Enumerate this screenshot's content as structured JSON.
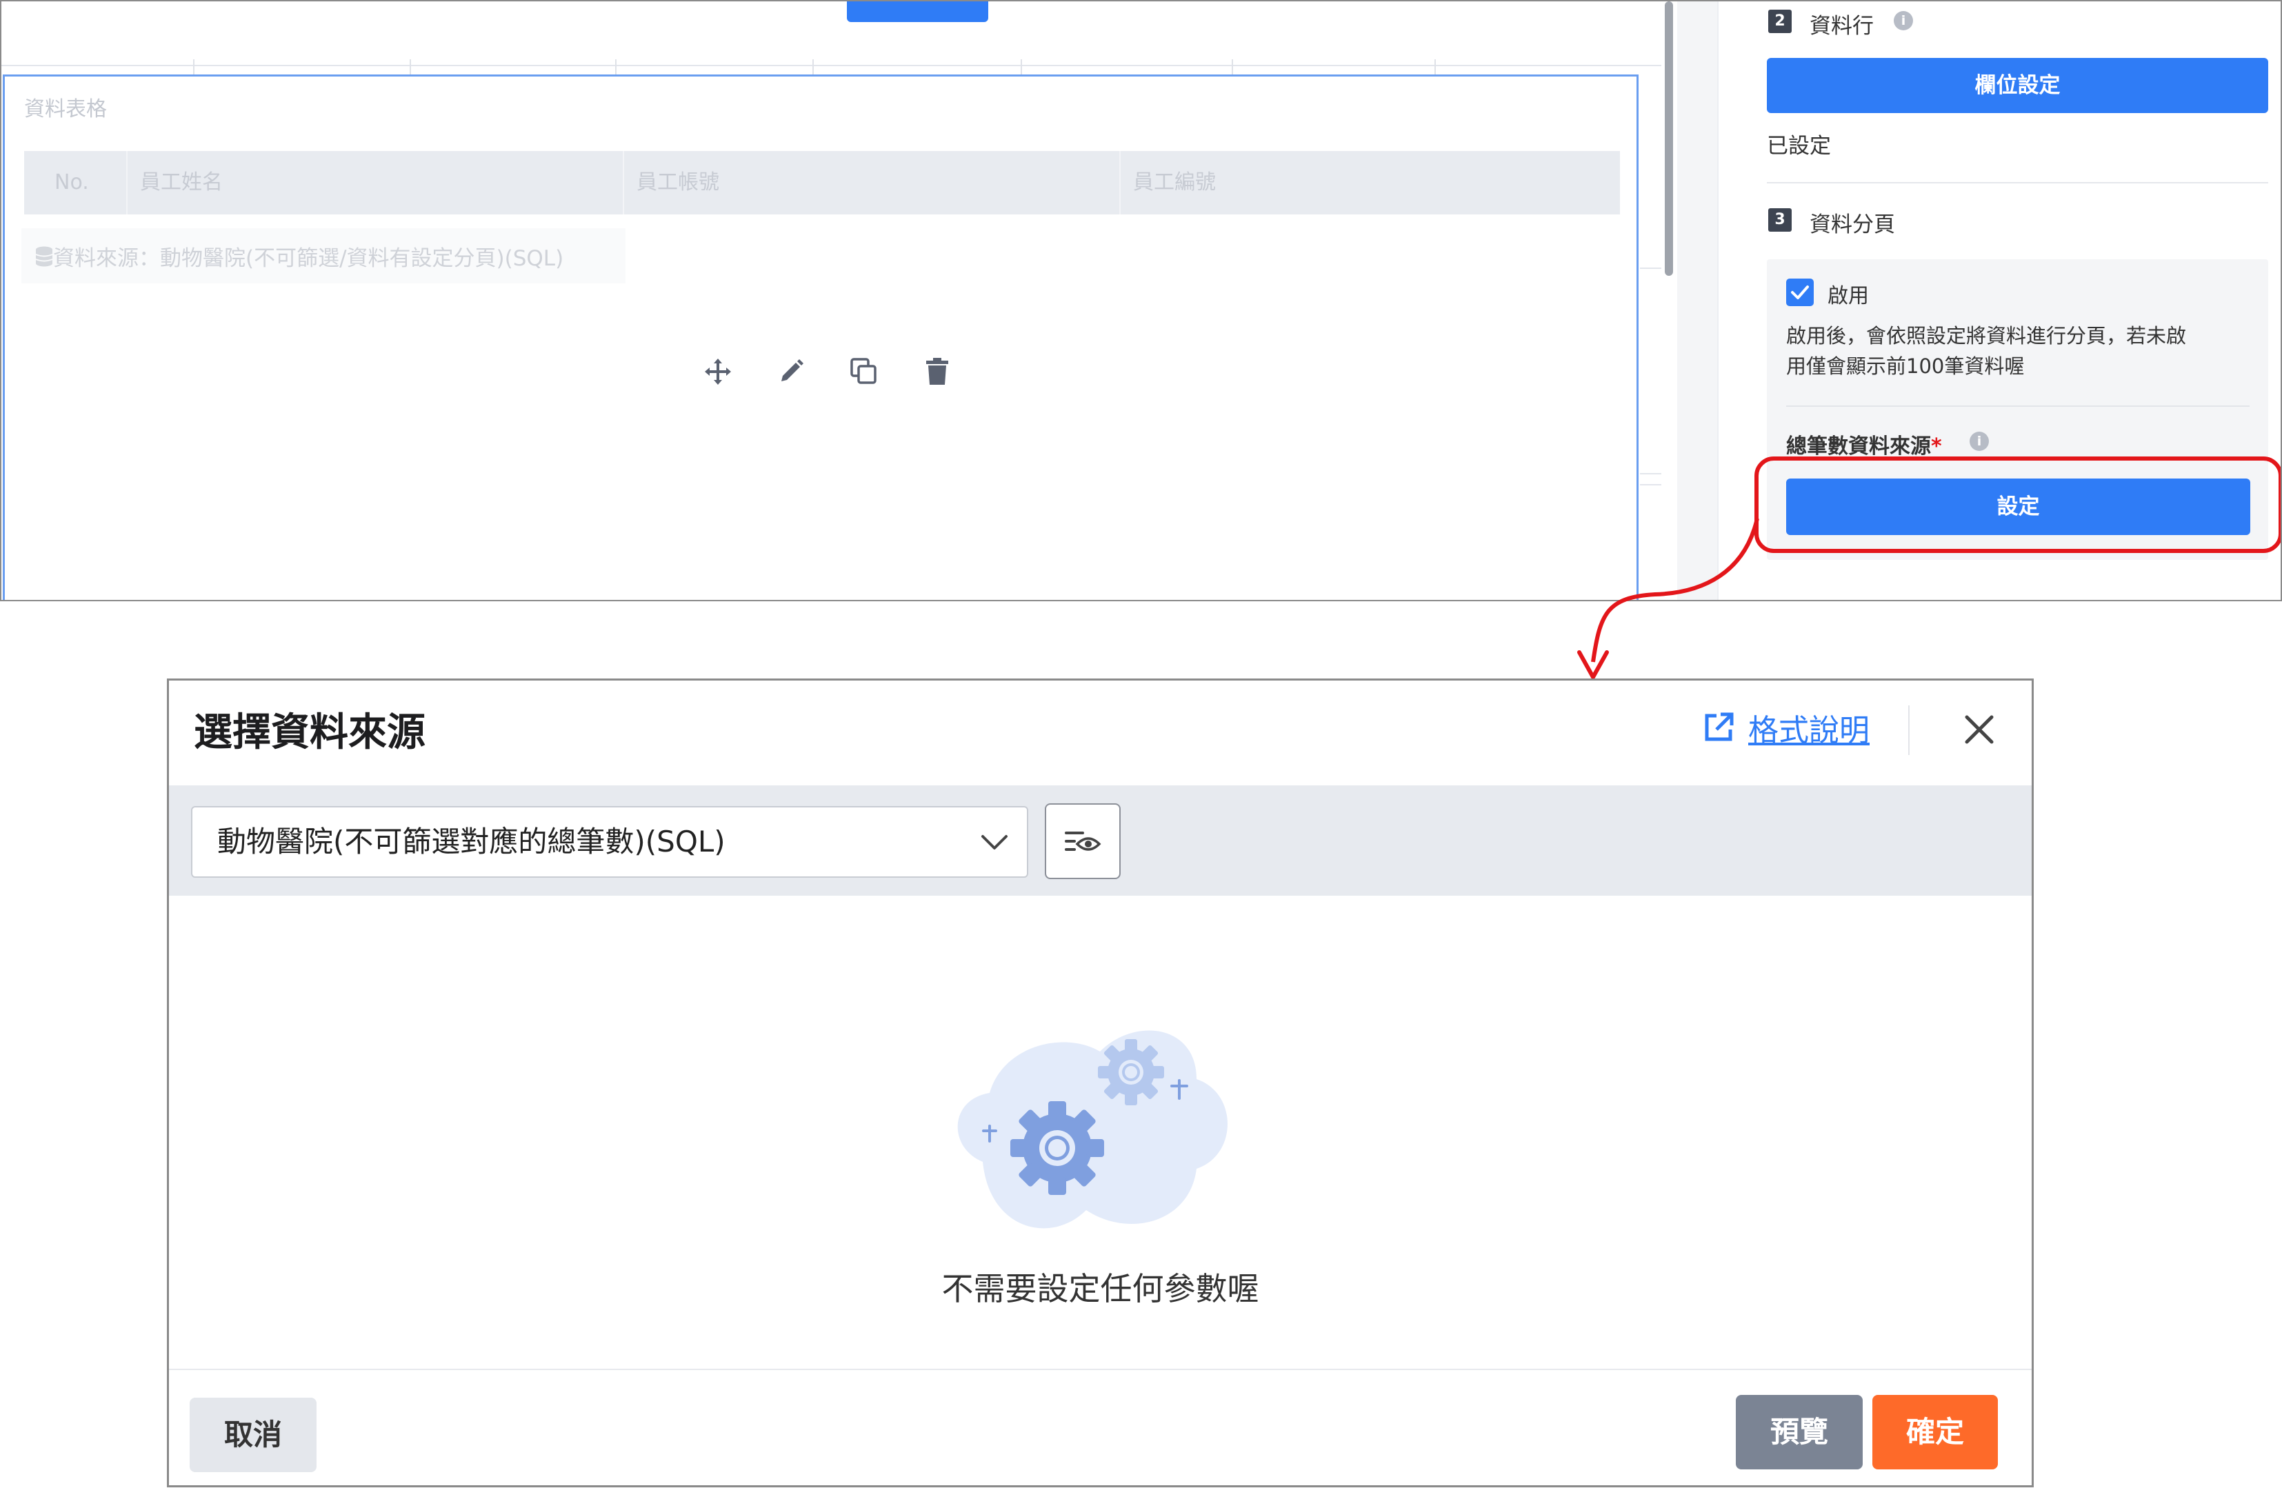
{
  "editor": {
    "table_widget": {
      "title": "資料表格",
      "columns": [
        "No.",
        "員工姓名",
        "員工帳號",
        "員工編號"
      ],
      "source_label": "資料來源：動物醫院(不可篩選/資料有設定分頁)(SQL)"
    },
    "widget_tools": [
      "move-icon",
      "edit-icon",
      "copy-icon",
      "delete-icon"
    ]
  },
  "sidebar": {
    "section2": {
      "number": "2",
      "title": "資料行",
      "button": "欄位設定",
      "status": "已設定"
    },
    "section3": {
      "number": "3",
      "title": "資料分頁",
      "enable_label": "啟用",
      "enabled": true,
      "description_line1": "啟用後，會依照設定將資料進行分頁，若未啟",
      "description_line2": "用僅會顯示前100筆資料喔",
      "total_source_label": "總筆數資料來源",
      "required_mark": "*",
      "button": "設定"
    }
  },
  "dialog": {
    "title": "選擇資料來源",
    "format_link": "格式說明",
    "selected_source": "動物醫院(不可篩選對應的總筆數)(SQL)",
    "empty_message": "不需要設定任何參數喔",
    "cancel": "取消",
    "preview": "預覽",
    "confirm": "確定"
  },
  "colors": {
    "primary": "#2f7cf6",
    "confirm": "#fe6a29",
    "preview": "#7b8494",
    "highlight": "#e3161a"
  }
}
